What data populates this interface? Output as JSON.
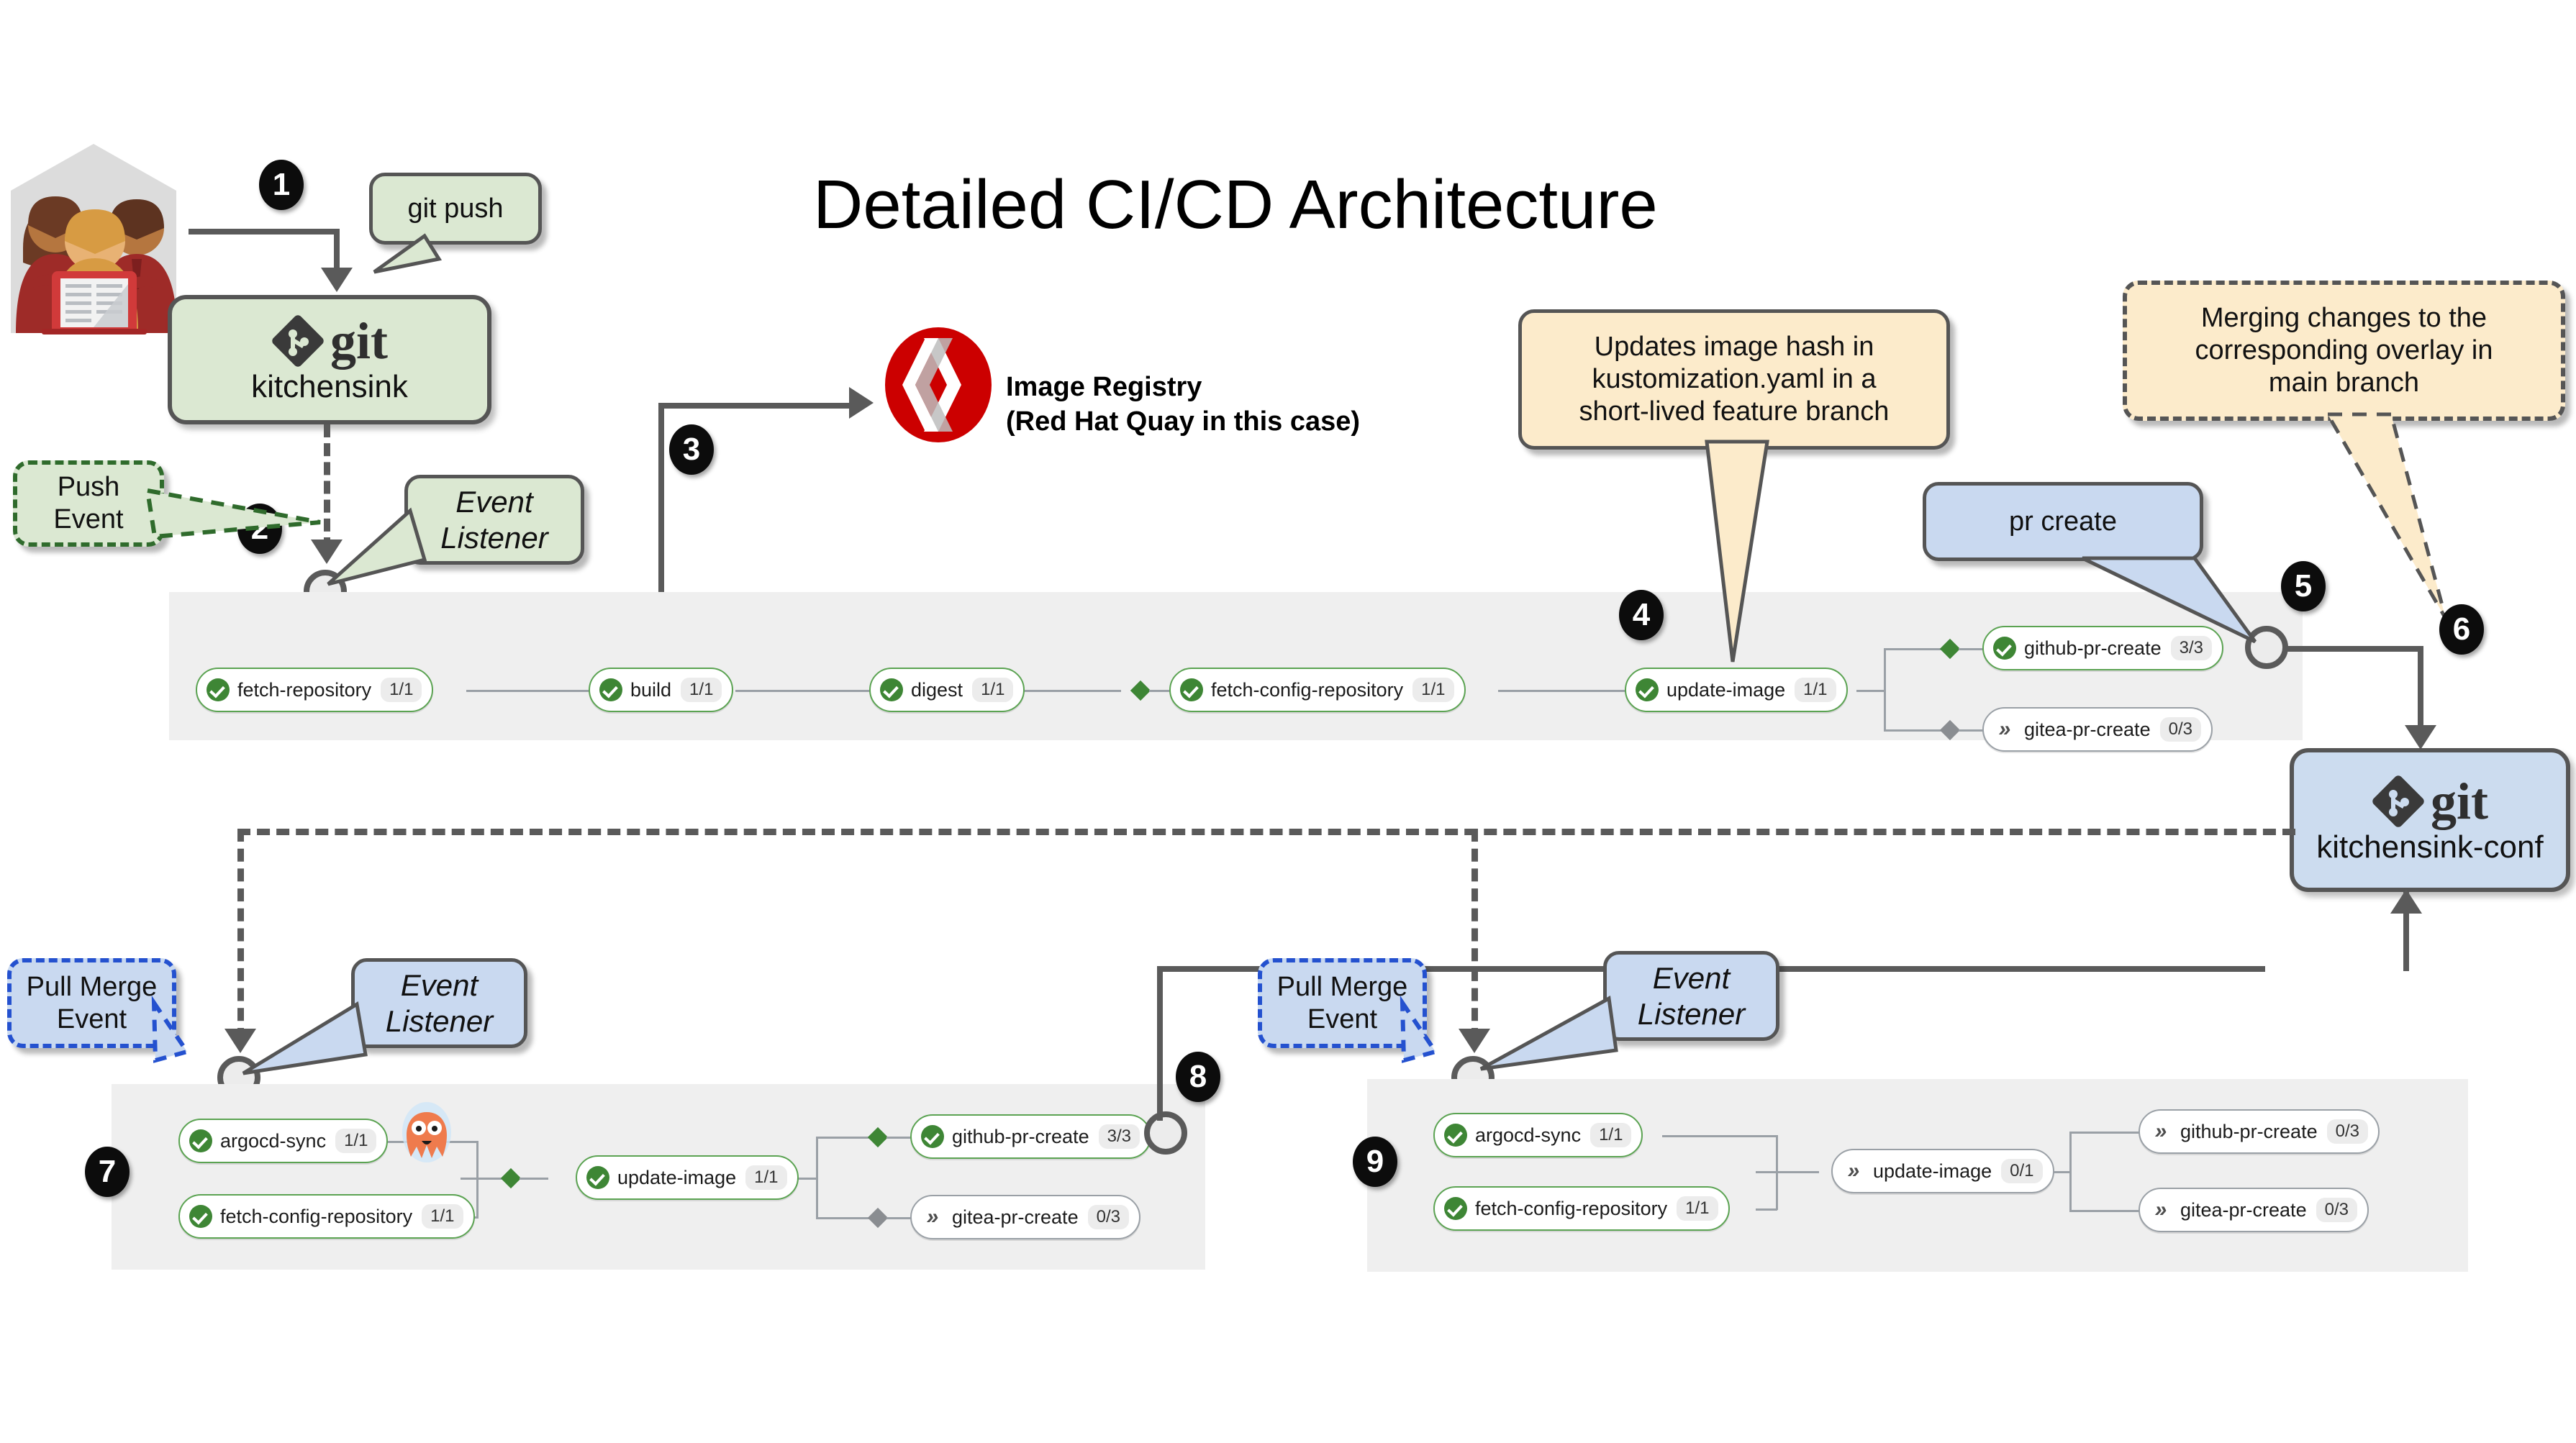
{
  "title": "Detailed CI/CD Architecture",
  "colors": {
    "panel_bg": "#efefef",
    "node_ok_border": "#5ba352",
    "node_skip_border": "#9aa0a6",
    "check_green": "#3e8635",
    "callout_green": "#dbe8d2",
    "callout_blue": "#c9d9f0",
    "callout_cream": "#fcebcb",
    "badge_black": "#0c0c0c",
    "connector_gray": "#5a5a5a",
    "quay_red": "#cc0000"
  },
  "actors": {
    "developers_icon": "developers-team-icon"
  },
  "repos": [
    {
      "id": "kitchensink",
      "logo": "git-logo",
      "name": "kitchensink",
      "style": "green"
    },
    {
      "id": "kitchensink-conf",
      "logo": "git-logo",
      "name": "kitchensink-conf",
      "style": "blue"
    }
  ],
  "registry": {
    "icon": "quay-logo",
    "line1": "Image Registry",
    "line2": "(Red Hat Quay in this case)"
  },
  "badges": [
    {
      "n": "1"
    },
    {
      "n": "2"
    },
    {
      "n": "3"
    },
    {
      "n": "4"
    },
    {
      "n": "5"
    },
    {
      "n": "6"
    },
    {
      "n": "7"
    },
    {
      "n": "8"
    },
    {
      "n": "9"
    }
  ],
  "callouts": [
    {
      "id": "git-push",
      "text": "git push",
      "style": "green"
    },
    {
      "id": "push-event",
      "text": "Push Event",
      "style": "green-dash"
    },
    {
      "id": "event-listener-1",
      "text": "Event Listener",
      "style": "green-italic"
    },
    {
      "id": "updates-image-hash",
      "text": "Updates image hash in kustomization.yaml in a short-lived feature branch",
      "style": "cream"
    },
    {
      "id": "pr-create",
      "text": "pr create",
      "style": "blue"
    },
    {
      "id": "merging-changes",
      "text": "Merging changes to the corresponding overlay in main branch",
      "style": "cream-dash"
    },
    {
      "id": "pull-merge-event-1",
      "text": "Pull Merge Event",
      "style": "blue-dash"
    },
    {
      "id": "event-listener-2",
      "text": "Event Listener",
      "style": "blue-italic"
    },
    {
      "id": "pull-merge-event-2",
      "text": "Pull Merge Event",
      "style": "blue-dash"
    },
    {
      "id": "event-listener-3",
      "text": "Event Listener",
      "style": "blue-italic"
    }
  ],
  "pipelines": [
    {
      "id": "build-pipeline",
      "tasks": [
        {
          "name": "fetch-repository",
          "count": "1/1",
          "status": "succeeded"
        },
        {
          "name": "build",
          "count": "1/1",
          "status": "succeeded"
        },
        {
          "name": "digest",
          "count": "1/1",
          "status": "succeeded"
        },
        {
          "name": "fetch-config-repository",
          "count": "1/1",
          "status": "succeeded"
        },
        {
          "name": "update-image",
          "count": "1/1",
          "status": "succeeded"
        },
        {
          "name": "github-pr-create",
          "count": "3/3",
          "status": "succeeded"
        },
        {
          "name": "gitea-pr-create",
          "count": "0/3",
          "status": "skipped"
        }
      ]
    },
    {
      "id": "deploy-pipeline-dev",
      "tasks": [
        {
          "name": "argocd-sync",
          "count": "1/1",
          "status": "succeeded"
        },
        {
          "name": "fetch-config-repository",
          "count": "1/1",
          "status": "succeeded"
        },
        {
          "name": "update-image",
          "count": "1/1",
          "status": "succeeded"
        },
        {
          "name": "github-pr-create",
          "count": "3/3",
          "status": "succeeded"
        },
        {
          "name": "gitea-pr-create",
          "count": "0/3",
          "status": "skipped"
        }
      ]
    },
    {
      "id": "deploy-pipeline-stage",
      "tasks": [
        {
          "name": "argocd-sync",
          "count": "1/1",
          "status": "succeeded"
        },
        {
          "name": "fetch-config-repository",
          "count": "1/1",
          "status": "succeeded"
        },
        {
          "name": "update-image",
          "count": "0/1",
          "status": "skipped"
        },
        {
          "name": "github-pr-create",
          "count": "0/3",
          "status": "skipped"
        },
        {
          "name": "gitea-pr-create",
          "count": "0/3",
          "status": "skipped"
        }
      ]
    }
  ],
  "mascot": {
    "icon": "argo-octopus-icon"
  }
}
